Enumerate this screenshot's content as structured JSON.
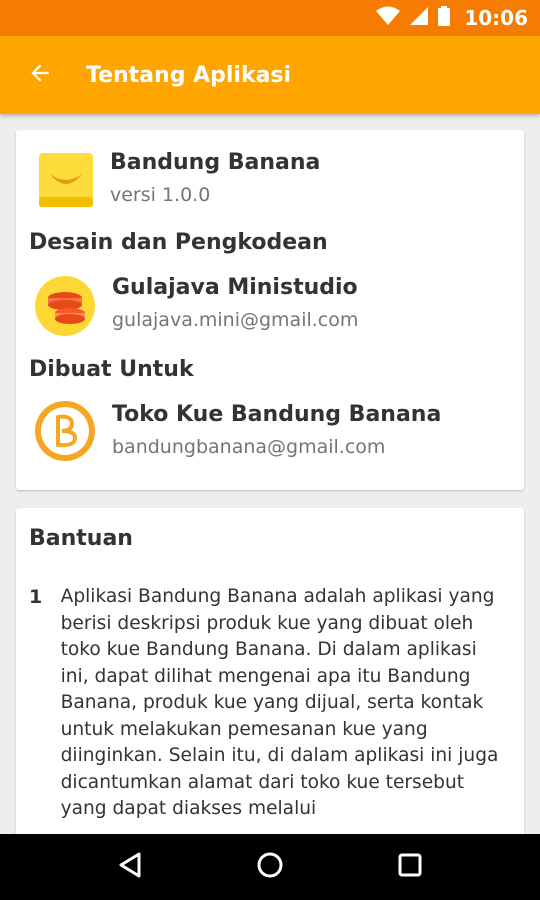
{
  "status_bar": {
    "time": "10:06",
    "icons": [
      "wifi-icon",
      "signal-icon",
      "battery-icon"
    ],
    "color": "#f57c00"
  },
  "app_bar": {
    "title": "Tentang Aplikasi",
    "back_icon": "arrow-back-icon",
    "color": "#ffa500"
  },
  "about": {
    "app": {
      "name": "Bandung Banana",
      "version": "versi 1.0.0",
      "icon": "banana-app-icon"
    },
    "design_section": "Desain dan Pengkodean",
    "developer": {
      "name": "Gulajava Ministudio",
      "email": "gulajava.mini@gmail.com",
      "icon": "macaron-logo-icon"
    },
    "made_for_section": "Dibuat Untuk",
    "client": {
      "name": "Toko Kue Bandung Banana",
      "email": "bandungbanana@gmail.com",
      "icon": "b-logo-icon"
    }
  },
  "help": {
    "title": "Bantuan",
    "items": [
      {
        "number": "1",
        "text": "Aplikasi Bandung Banana adalah aplikasi yang berisi deskripsi produk kue yang dibuat oleh toko kue Bandung Banana. Di dalam aplikasi ini, dapat dilihat mengenai apa itu Bandung Banana, produk kue yang dijual, serta kontak untuk melakukan pemesanan kue yang diinginkan. Selain itu, di dalam aplikasi ini juga dicantumkan alamat dari toko kue tersebut yang dapat diakses melalui"
      }
    ]
  },
  "nav_bar": {
    "buttons": [
      "back-triangle-icon",
      "home-circle-icon",
      "recents-square-icon"
    ]
  }
}
